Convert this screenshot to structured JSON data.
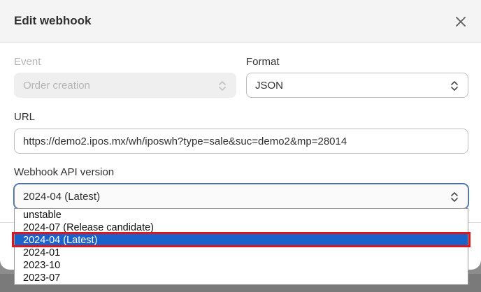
{
  "modal": {
    "title": "Edit webhook",
    "close_icon": "close-icon"
  },
  "event": {
    "label": "Event",
    "value": "Order creation",
    "disabled": true
  },
  "format": {
    "label": "Format",
    "value": "JSON"
  },
  "url": {
    "label": "URL",
    "value": "https://demo2.ipos.mx/wh/iposwh?type=sale&suc=demo2&mp=28014"
  },
  "api_version": {
    "label": "Webhook API version",
    "value": "2024-04 (Latest)",
    "options": [
      "unstable",
      "2024-07 (Release candidate)",
      "2024-04 (Latest)",
      "2024-01",
      "2023-10",
      "2023-07"
    ],
    "selected_index": 2
  },
  "colors": {
    "selected_option": "#1a62c9",
    "annotation_highlight": "#e0151b",
    "focus_ring": "#2c6ecb"
  },
  "icons": {
    "chevron": "chevron-up-down-icon"
  }
}
